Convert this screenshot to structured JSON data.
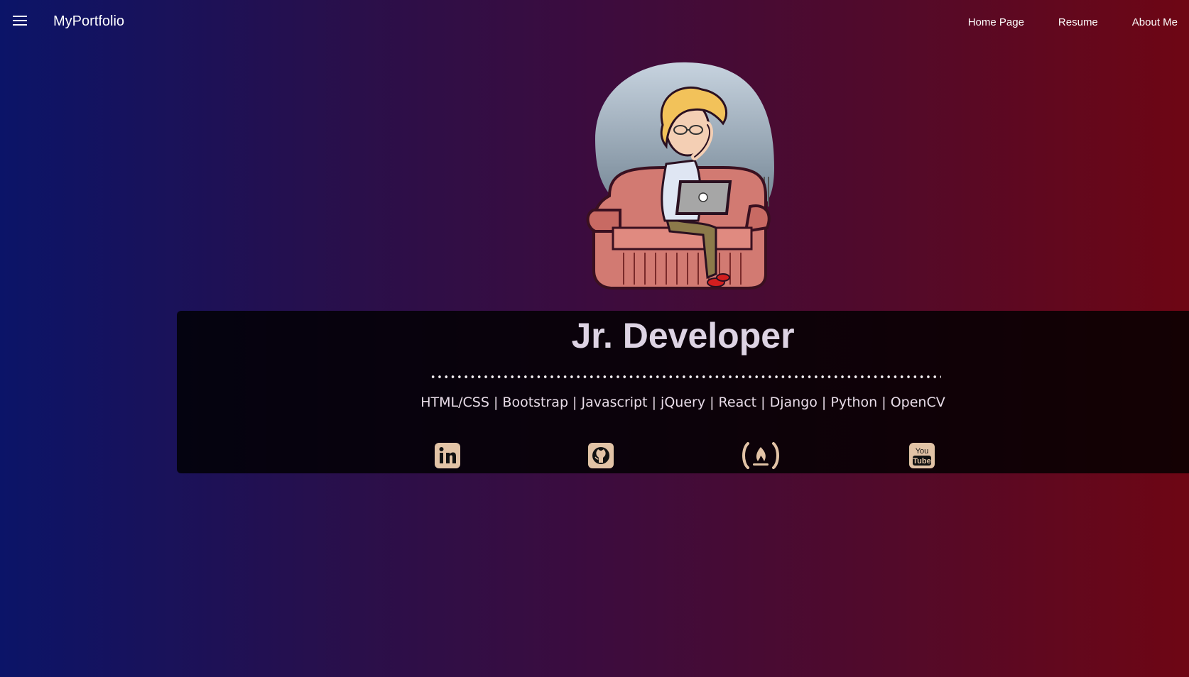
{
  "nav": {
    "brand": "MyPortfolio",
    "links": [
      "Home Page",
      "Resume",
      "About Me"
    ]
  },
  "hero": {
    "title": "Jr. Developer",
    "skills": "HTML/CSS | Bootstrap | Javascript | jQuery | React | Django | Python | OpenCV"
  },
  "social": [
    {
      "icon": "linkedin-icon"
    },
    {
      "icon": "github-icon"
    },
    {
      "icon": "freecodecamp-icon"
    },
    {
      "icon": "youtube-icon"
    }
  ],
  "colors": {
    "icon": "#e2c3a6",
    "title": "#ddd3e3",
    "gradient_left": "#0b1468",
    "gradient_right": "#6e0614"
  }
}
